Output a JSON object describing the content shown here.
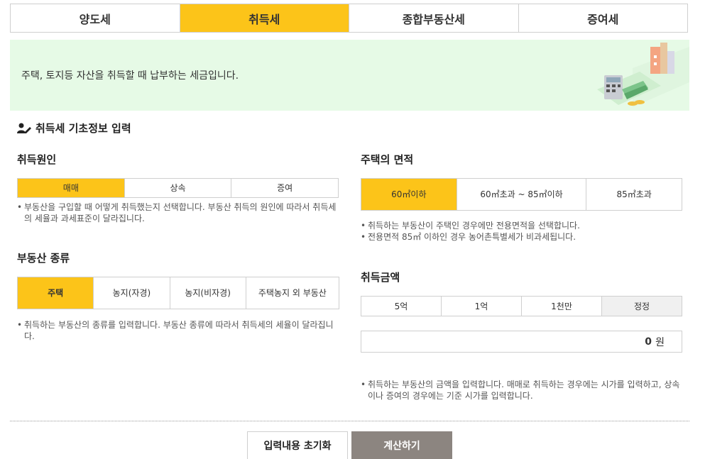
{
  "tabs": [
    {
      "label": "양도세",
      "active": false
    },
    {
      "label": "취득세",
      "active": true
    },
    {
      "label": "종합부동산세",
      "active": false
    },
    {
      "label": "증여세",
      "active": false
    }
  ],
  "banner": {
    "text": "주택, 토지등 자산을 취득할 때 납부하는 세금입니다."
  },
  "section": {
    "title": "취득세 기초정보 입력"
  },
  "cause": {
    "label": "취득원인",
    "options": [
      "매매",
      "상속",
      "증여"
    ],
    "selected": "매매",
    "note": [
      "부동산을 구입할 때 어떻게 취득했는지 선택합니다. 부동산 취득의 원인에 따라서 취득세의 세율과 과세표준이 달라집니다."
    ]
  },
  "property_type": {
    "label": "부동산 종류",
    "options": [
      "주택",
      "농지(자경)",
      "농지(비자경)",
      "주택농지 외 부동산"
    ],
    "selected": "주택",
    "note": [
      "취득하는 부동산의 종류를 입력합니다. 부동산 종류에 따라서 취득세의 세율이 달라집니다."
    ]
  },
  "area": {
    "label": "주택의 면적",
    "options": [
      "60㎡이하",
      "60㎡초과 ~ 85㎡이하",
      "85㎡초과"
    ],
    "selected": "60㎡이하",
    "note": [
      "취득하는 부동산이 주택인 경우에만 전용면적을 선택합니다.",
      "전용면적 85㎡ 이하인 경우 농어촌특별세가 비과세됩니다."
    ]
  },
  "amount": {
    "label": "취득금액",
    "quick_buttons": [
      "5억",
      "1억",
      "1천만",
      "정정"
    ],
    "value": "0",
    "unit": "원",
    "note": [
      "취득하는 부동산의 금액을 입력합니다. 매매로 취득하는 경우에는 시가를 입력하고, 상속이나 증여의 경우에는 기준 시가를 입력합니다."
    ]
  },
  "actions": {
    "reset": "입력내용 초기화",
    "calculate": "계산하기"
  },
  "colors": {
    "accent": "#fcc419",
    "banner_bg": "#e6fae6",
    "calc_button": "#8c8580"
  }
}
